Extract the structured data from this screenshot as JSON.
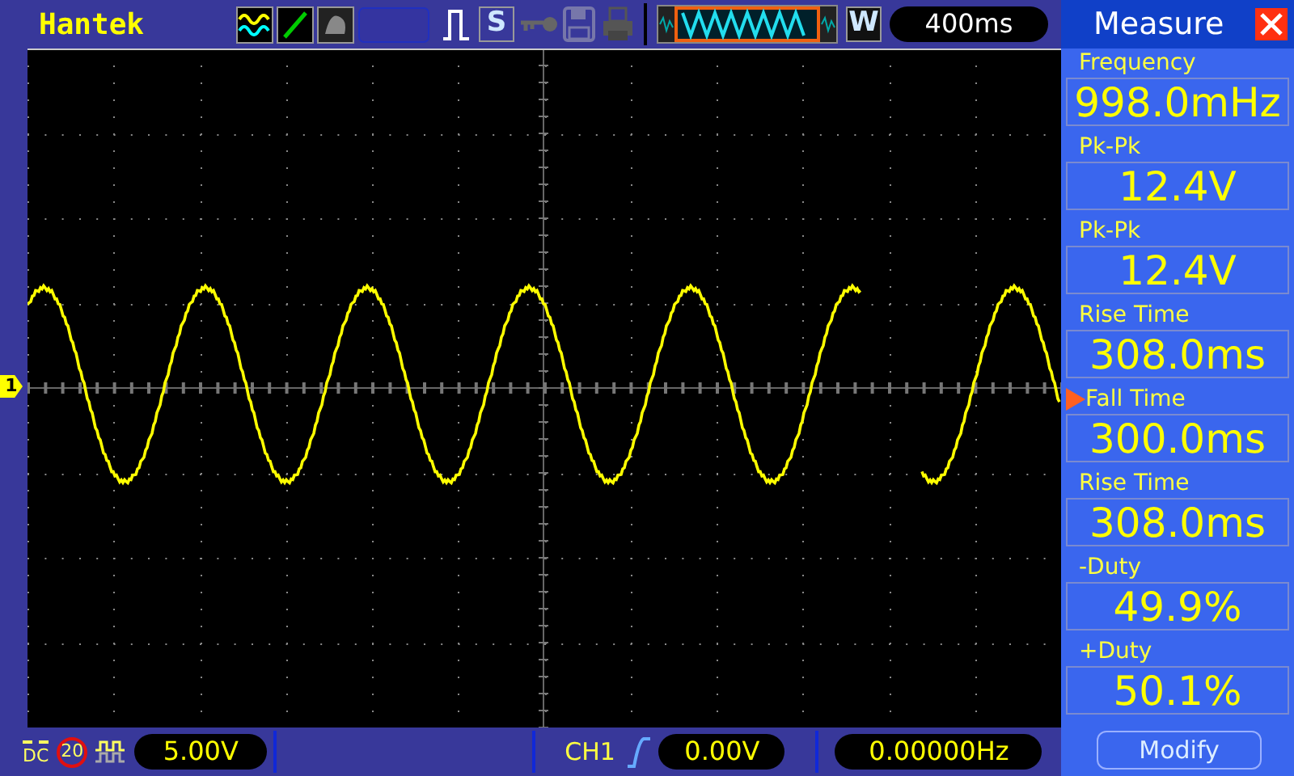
{
  "header": {
    "logo": "Hantek",
    "mode_button": "S",
    "zoom_button": "W",
    "timebase": "400ms"
  },
  "channel_marker": "1",
  "measure_panel": {
    "title": "Measure",
    "items": [
      {
        "label": "Frequency",
        "value": "998.0mHz",
        "selected": false
      },
      {
        "label": "Pk-Pk",
        "value": "12.4V",
        "selected": false
      },
      {
        "label": "Pk-Pk",
        "value": "12.4V",
        "selected": false
      },
      {
        "label": "Rise Time",
        "value": "308.0ms",
        "selected": false
      },
      {
        "label": "Fall Time",
        "value": "300.0ms",
        "selected": true
      },
      {
        "label": "Rise Time",
        "value": "308.0ms",
        "selected": false
      },
      {
        "label": "-Duty",
        "value": "49.9%",
        "selected": false
      },
      {
        "label": "+Duty",
        "value": "50.1%",
        "selected": false
      }
    ],
    "modify_button": "Modify"
  },
  "status_bar": {
    "coupling": "DC",
    "bandwidth_limit": "20",
    "volts_per_div": "5.00V",
    "trigger_source": "CH1",
    "trigger_level": "0.00V",
    "trigger_frequency": "0.00000Hz"
  }
}
